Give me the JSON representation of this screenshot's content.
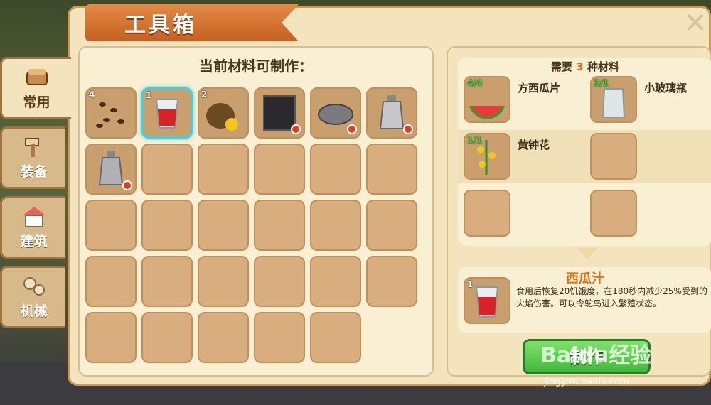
{
  "window": {
    "title": "工具箱",
    "close_icon": "close-icon"
  },
  "tabs": [
    {
      "label": "常用",
      "icon": "bread-icon",
      "active": true
    },
    {
      "label": "装备",
      "icon": "hammer-icon",
      "active": false
    },
    {
      "label": "建筑",
      "icon": "house-icon",
      "active": false
    },
    {
      "label": "机械",
      "icon": "gears-icon",
      "active": false
    }
  ],
  "craftable": {
    "title": "当前材料可制作：",
    "items": [
      {
        "icon": "seeds-icon",
        "count": "4",
        "unavailable": false,
        "selected": false
      },
      {
        "icon": "watermelon-juice-icon",
        "count": "1",
        "unavailable": false,
        "selected": true
      },
      {
        "icon": "flower-pouch-icon",
        "count": "2",
        "unavailable": false,
        "selected": false
      },
      {
        "icon": "dark-block-icon",
        "count": "",
        "unavailable": true,
        "selected": false
      },
      {
        "icon": "stone-bowl-icon",
        "count": "",
        "unavailable": true,
        "selected": false
      },
      {
        "icon": "sand-bottle-icon",
        "count": "",
        "unavailable": true,
        "selected": false
      },
      {
        "icon": "gray-bottle-icon",
        "count": "",
        "unavailable": true,
        "selected": false
      }
    ],
    "total_slots": 30
  },
  "requirements": {
    "prefix": "需要",
    "count": "3",
    "suffix": "种材料",
    "materials": [
      {
        "name": "方西瓜片",
        "count": "4/4",
        "icon": "watermelon-slice-icon"
      },
      {
        "name": "小玻璃瓶",
        "count": "3/1",
        "icon": "glass-bottle-icon"
      },
      {
        "name": "黄钟花",
        "count": "1/1",
        "icon": "yellow-bell-flower-icon"
      }
    ]
  },
  "result": {
    "name": "西瓜汁",
    "count": "1",
    "icon": "watermelon-juice-icon",
    "description": "食用后恢复20饥饿度，在180秒内减少25%受到的火焰伤害。可以令鸵鸟进入繁殖状态。"
  },
  "make_button": {
    "label": "制作"
  },
  "watermark": {
    "brand": "Baidu经验",
    "url": "jingyan.baidu.com"
  }
}
